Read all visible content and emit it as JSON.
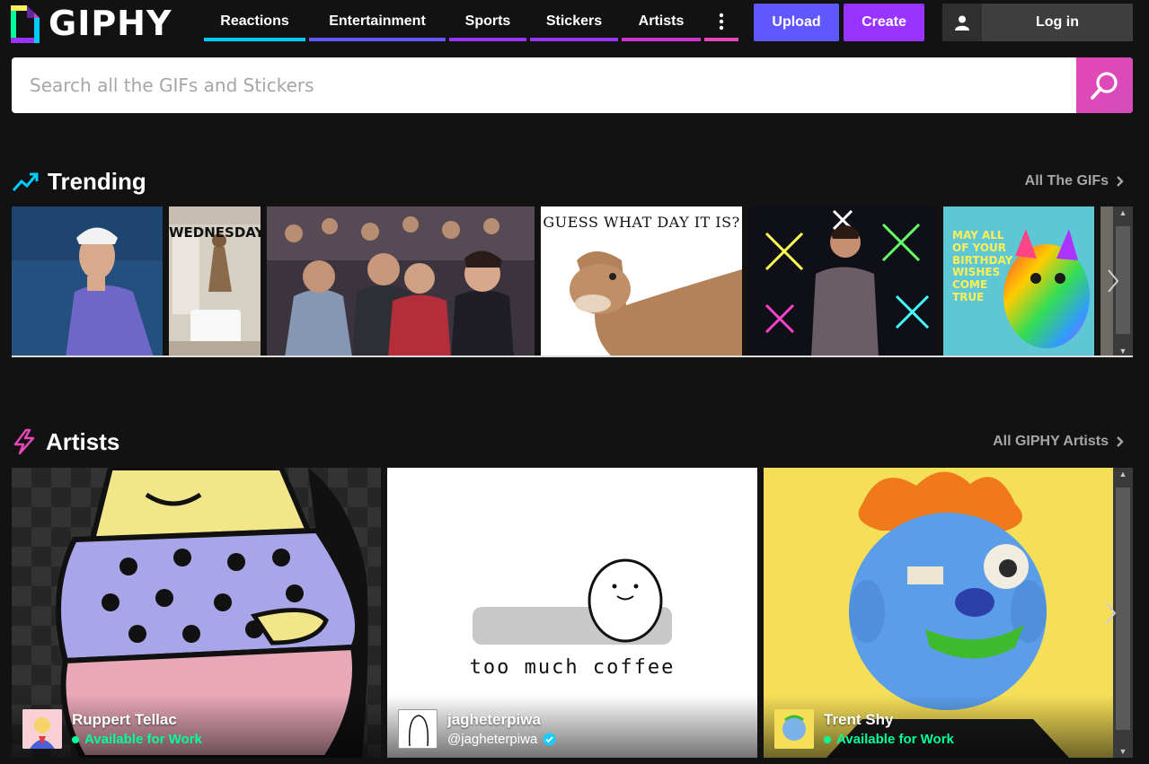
{
  "brand": {
    "name": "GIPHY"
  },
  "nav": {
    "items": [
      {
        "label": "Reactions",
        "color": "#00ccff"
      },
      {
        "label": "Entertainment",
        "color": "#6157ff"
      },
      {
        "label": "Sports",
        "color": "#9933ff"
      },
      {
        "label": "Stickers",
        "color": "#9933ff"
      },
      {
        "label": "Artists",
        "color": "#cc33cc"
      }
    ],
    "more_color": "#e646b6"
  },
  "header": {
    "upload_label": "Upload",
    "create_label": "Create",
    "login_label": "Log in"
  },
  "search": {
    "placeholder": "Search all the GIFs and Stickers"
  },
  "trending": {
    "title": "Trending",
    "link_label": "All The GIFs",
    "gifs": [
      {
        "caption": ""
      },
      {
        "caption": "WEDNESDAY"
      },
      {
        "caption": ""
      },
      {
        "caption": "GUESS WHAT DAY IT IS?"
      },
      {
        "caption": ""
      },
      {
        "caption": "MAY ALL OF YOUR BIRTHDAY WISHES COME TRUE"
      }
    ]
  },
  "artists": {
    "title": "Artists",
    "link_label": "All GIPHY Artists",
    "cards": [
      {
        "name": "Ruppert Tellac",
        "status": "Available for Work"
      },
      {
        "name": "jagheterpiwa",
        "handle": "@jagheterpiwa",
        "caption": "too much coffee"
      },
      {
        "name": "Trent Shy",
        "status": "Available for Work"
      }
    ]
  },
  "colors": {
    "upload": "#6157ff",
    "create": "#9933ff",
    "search_button": "#e646b6",
    "available": "#00ff99",
    "verified": "#15cdff"
  }
}
